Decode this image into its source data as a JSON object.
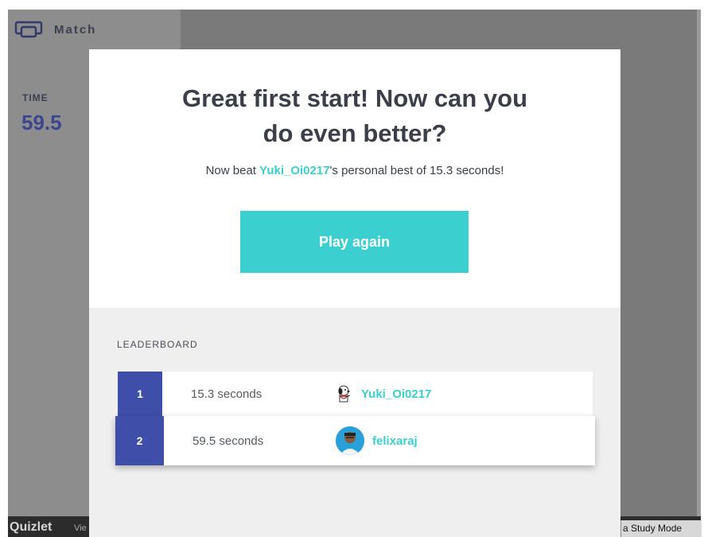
{
  "sidebar": {
    "mode_label": "Match",
    "time_label": "TIME",
    "time_value": "59.5"
  },
  "footer": {
    "logo": "Quizlet",
    "view_text": "Vie",
    "study_mode": "a Study Mode"
  },
  "modal": {
    "headline_line1": "Great first start! Now can you",
    "headline_line2": "do even better?",
    "sub_prefix": "Now beat ",
    "sub_user": "Yuki_Oi0217",
    "sub_suffix": "'s personal best of 15.3 seconds!",
    "play_again_label": "Play again"
  },
  "leaderboard": {
    "title": "LEADERBOARD",
    "rows": [
      {
        "rank": "1",
        "time": "15.3 seconds",
        "user": "Yuki_Oi0217"
      },
      {
        "rank": "2",
        "time": "59.5 seconds",
        "user": "felixaraj"
      }
    ]
  },
  "colors": {
    "accent": "#3ccfcf",
    "rank_bg": "#3f4fa9",
    "time_value": "#3a4790"
  }
}
